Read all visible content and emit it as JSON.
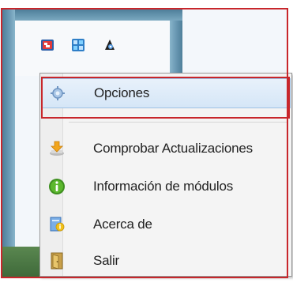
{
  "tray": {
    "icons": [
      "tool-icon",
      "network-icon",
      "media-icon"
    ]
  },
  "menu": {
    "items": [
      {
        "label": "Opciones",
        "icon": "gear-icon"
      },
      {
        "label": "Comprobar Actualizaciones",
        "icon": "download-icon"
      },
      {
        "label": "Información de módulos",
        "icon": "info-icon"
      },
      {
        "label": "Acerca de",
        "icon": "about-icon"
      },
      {
        "label": "Salir",
        "icon": "door-icon"
      }
    ]
  },
  "colors": {
    "highlight_frame": "#c8262b",
    "selection": "#d5e6f7"
  }
}
